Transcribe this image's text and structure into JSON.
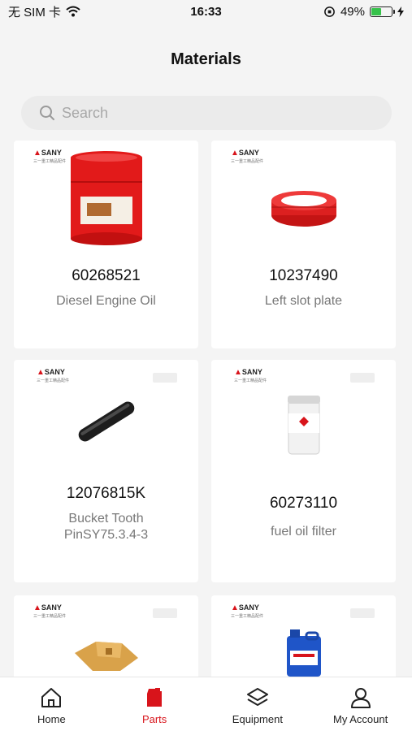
{
  "status_bar": {
    "carrier": "无 SIM 卡",
    "time": "16:33",
    "battery": "49%",
    "battery_level": 0.49
  },
  "header": {
    "title": "Materials"
  },
  "search": {
    "placeholder": "Search"
  },
  "brand": {
    "name": "SANY",
    "subtitle": "三一重工精品配件"
  },
  "products": [
    {
      "code": "60268521",
      "name": "Diesel Engine Oil",
      "image_icon": "oil-drum-icon"
    },
    {
      "code": "10237490",
      "name": "Left slot plate",
      "image_icon": "red-seal-ring-icon"
    },
    {
      "code": "12076815K",
      "name": "Bucket Tooth PinSY75.3.4-3",
      "image_icon": "tooth-pin-icon"
    },
    {
      "code": "60273110",
      "name": "fuel oil filter",
      "image_icon": "fuel-filter-icon"
    },
    {
      "code": "",
      "name": "",
      "image_icon": "bucket-tooth-icon"
    },
    {
      "code": "",
      "name": "",
      "image_icon": "oil-jug-icon"
    }
  ],
  "tabs": [
    {
      "label": "Home",
      "icon": "home-icon",
      "active": false
    },
    {
      "label": "Parts",
      "icon": "parts-icon",
      "active": true
    },
    {
      "label": "Equipment",
      "icon": "layers-icon",
      "active": false
    },
    {
      "label": "My Account",
      "icon": "person-icon",
      "active": false
    }
  ],
  "colors": {
    "accent": "#d8141b",
    "background": "#f4f4f4",
    "card": "#ffffff"
  }
}
